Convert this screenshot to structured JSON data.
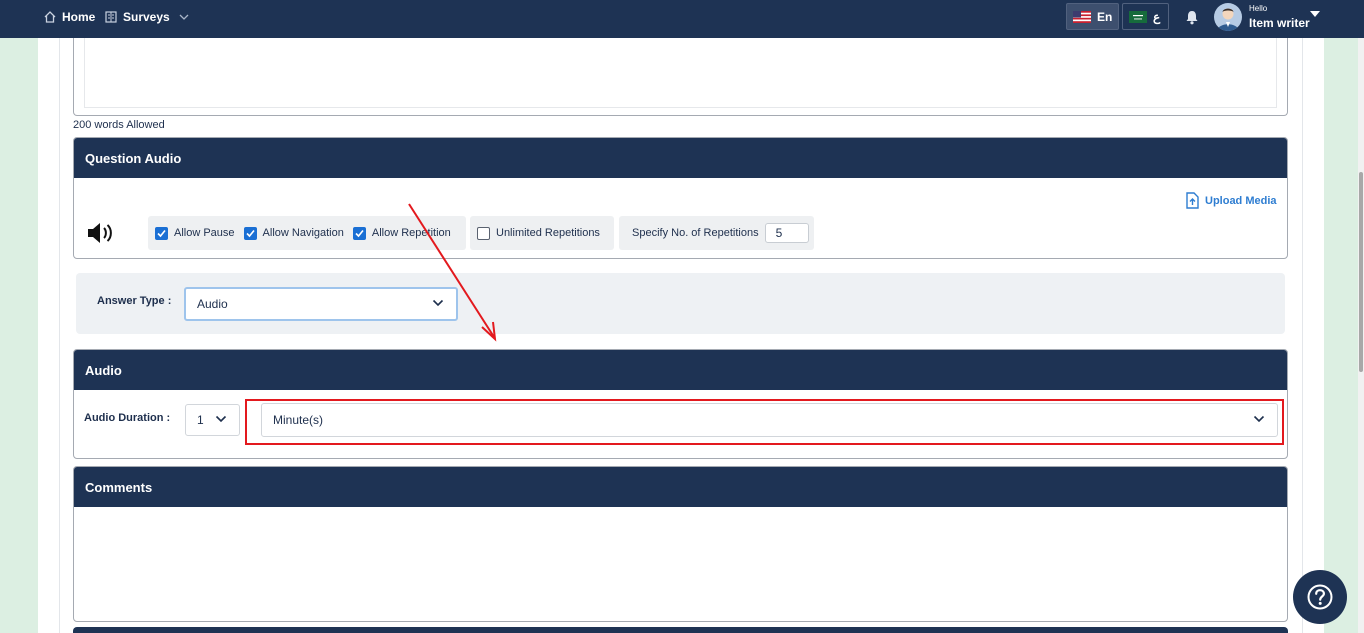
{
  "nav": {
    "home": "Home",
    "surveys": "Surveys"
  },
  "header": {
    "lang_en": "En",
    "lang_ar": "ع",
    "greeting": "Hello",
    "username": "Item writer"
  },
  "question_text": {
    "limit_note": "200 words Allowed"
  },
  "question_audio": {
    "title": "Question Audio",
    "upload_label": "Upload Media",
    "allow_pause": {
      "label": "Allow Pause",
      "checked": true
    },
    "allow_navigation": {
      "label": "Allow Navigation",
      "checked": true
    },
    "allow_repetition": {
      "label": "Allow Repetition",
      "checked": true
    },
    "unlimited_repetitions": {
      "label": "Unlimited Repetitions",
      "checked": false
    },
    "repetitions_label": "Specify No. of Repetitions",
    "repetitions_value": "5"
  },
  "answer_type": {
    "label": "Answer Type :",
    "value": "Audio"
  },
  "audio": {
    "title": "Audio",
    "duration_label": "Audio Duration :",
    "duration_value": "1",
    "duration_unit": "Minute(s)"
  },
  "comments": {
    "title": "Comments"
  },
  "colors": {
    "navy": "#1e3354",
    "accent_blue": "#1a6fd4",
    "link_blue": "#2e7dd1",
    "annotation_red": "#e3191e",
    "page_bg": "#dcefe2"
  },
  "icons": {
    "home": "home-icon",
    "surveys": "survey-icon",
    "bell": "bell-icon",
    "upload": "upload-file-icon",
    "speaker": "speaker-icon",
    "help": "help-icon"
  }
}
